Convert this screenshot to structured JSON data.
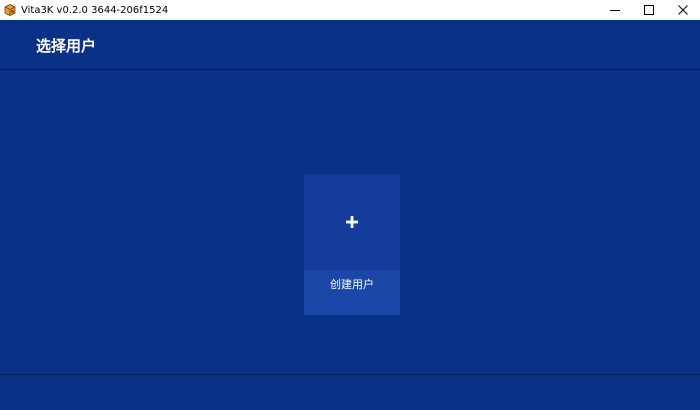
{
  "window": {
    "title": "Vita3K v0.2.0 3644-206f1524",
    "icons": {
      "app": "vita3k-logo-icon",
      "minimize": "minimize-icon",
      "maximize": "maximize-icon",
      "close": "close-icon"
    }
  },
  "header": {
    "title": "选择用户"
  },
  "main": {
    "create_user": {
      "icon": "plus-icon",
      "label": "创建用户"
    }
  },
  "colors": {
    "background": "#0a3188",
    "tile": "#133c9b",
    "tile_label": "#1a47a8",
    "text": "#ffffff"
  }
}
